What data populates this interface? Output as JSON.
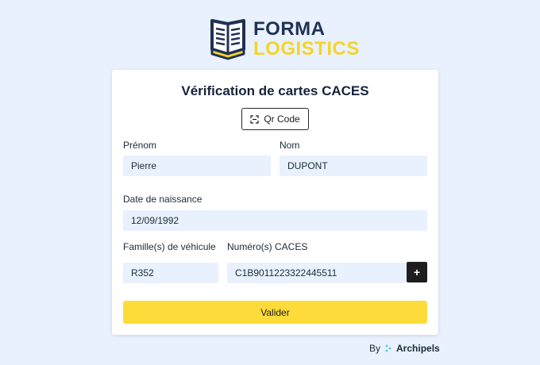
{
  "logo": {
    "line1": "FORMA",
    "line2": "LOGISTICS"
  },
  "form": {
    "title": "Vérification de cartes CACES",
    "qr_button_label": "Qr Code",
    "qr_icon": "qr-scan-icon",
    "firstname_label": "Prénom",
    "firstname_value": "Pierre",
    "lastname_label": "Nom",
    "lastname_value": "DUPONT",
    "birthdate_label": "Date de naissance",
    "birthdate_value": "12/09/1992",
    "family_label": "Famille(s) de véhicule",
    "family_value": "R352",
    "caces_label": "Numéro(s) CACES",
    "caces_value": "C1B9011223322445511",
    "add_button_label": "+",
    "submit_label": "Valider"
  },
  "footer": {
    "by": "By",
    "brand": "Archipels"
  },
  "colors": {
    "background": "#e8f1fd",
    "navy": "#1f3154",
    "yellow": "#f6d32a",
    "button_yellow": "#fddb3a",
    "field_bg": "#e8f1fd"
  }
}
